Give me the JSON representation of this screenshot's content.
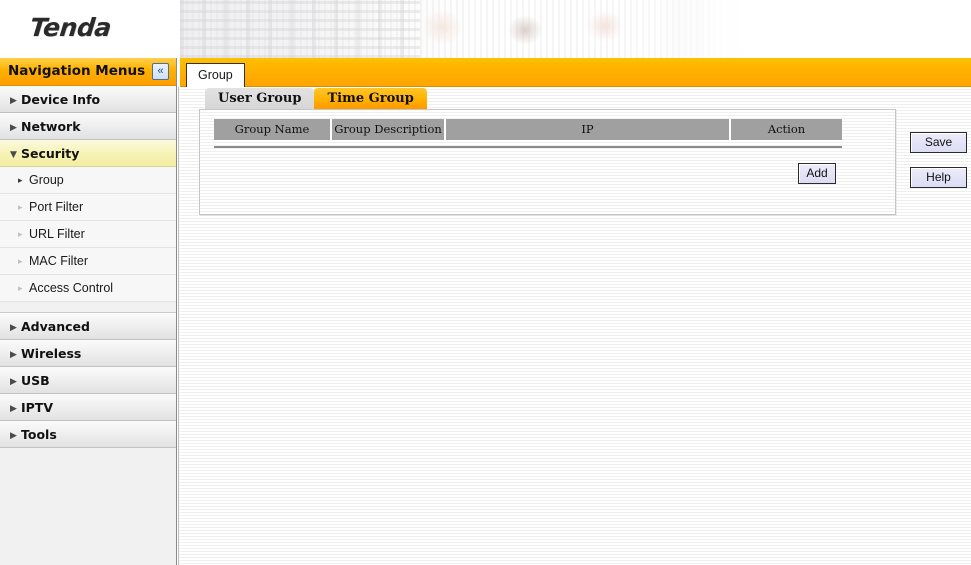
{
  "brand": {
    "logo_text": "Tenda"
  },
  "nav": {
    "header_title": "Navigation Menus",
    "collapse_icon": "«",
    "expanded_arrow": "▼",
    "collapsed_arrow": "▶",
    "sub_arrow": "▸",
    "items": [
      {
        "label": "Device Info",
        "expanded": false
      },
      {
        "label": "Network",
        "expanded": false
      },
      {
        "label": "Security",
        "expanded": true
      },
      {
        "label": "Advanced",
        "expanded": false
      },
      {
        "label": "Wireless",
        "expanded": false
      },
      {
        "label": "USB",
        "expanded": false
      },
      {
        "label": "IPTV",
        "expanded": false
      },
      {
        "label": "Tools",
        "expanded": false
      }
    ],
    "security_subitems": [
      {
        "label": "Group",
        "active": true
      },
      {
        "label": "Port Filter",
        "active": false
      },
      {
        "label": "URL Filter",
        "active": false
      },
      {
        "label": "MAC Filter",
        "active": false
      },
      {
        "label": "Access Control",
        "active": false
      }
    ]
  },
  "main_tab": {
    "label": "Group"
  },
  "subtabs": [
    {
      "label": "User Group",
      "active": false
    },
    {
      "label": "Time Group",
      "active": true
    }
  ],
  "table": {
    "columns": [
      "Group Name",
      "Group Description",
      "IP",
      "Action"
    ],
    "rows": []
  },
  "buttons": {
    "add": "Add",
    "save": "Save",
    "help": "Help"
  },
  "colors": {
    "accent_orange": "#ffb000",
    "nav_highlight_yellow": "#f6f2b4",
    "table_header_gray": "#a0a0a0",
    "button_lavender": "#e2e2f6"
  }
}
